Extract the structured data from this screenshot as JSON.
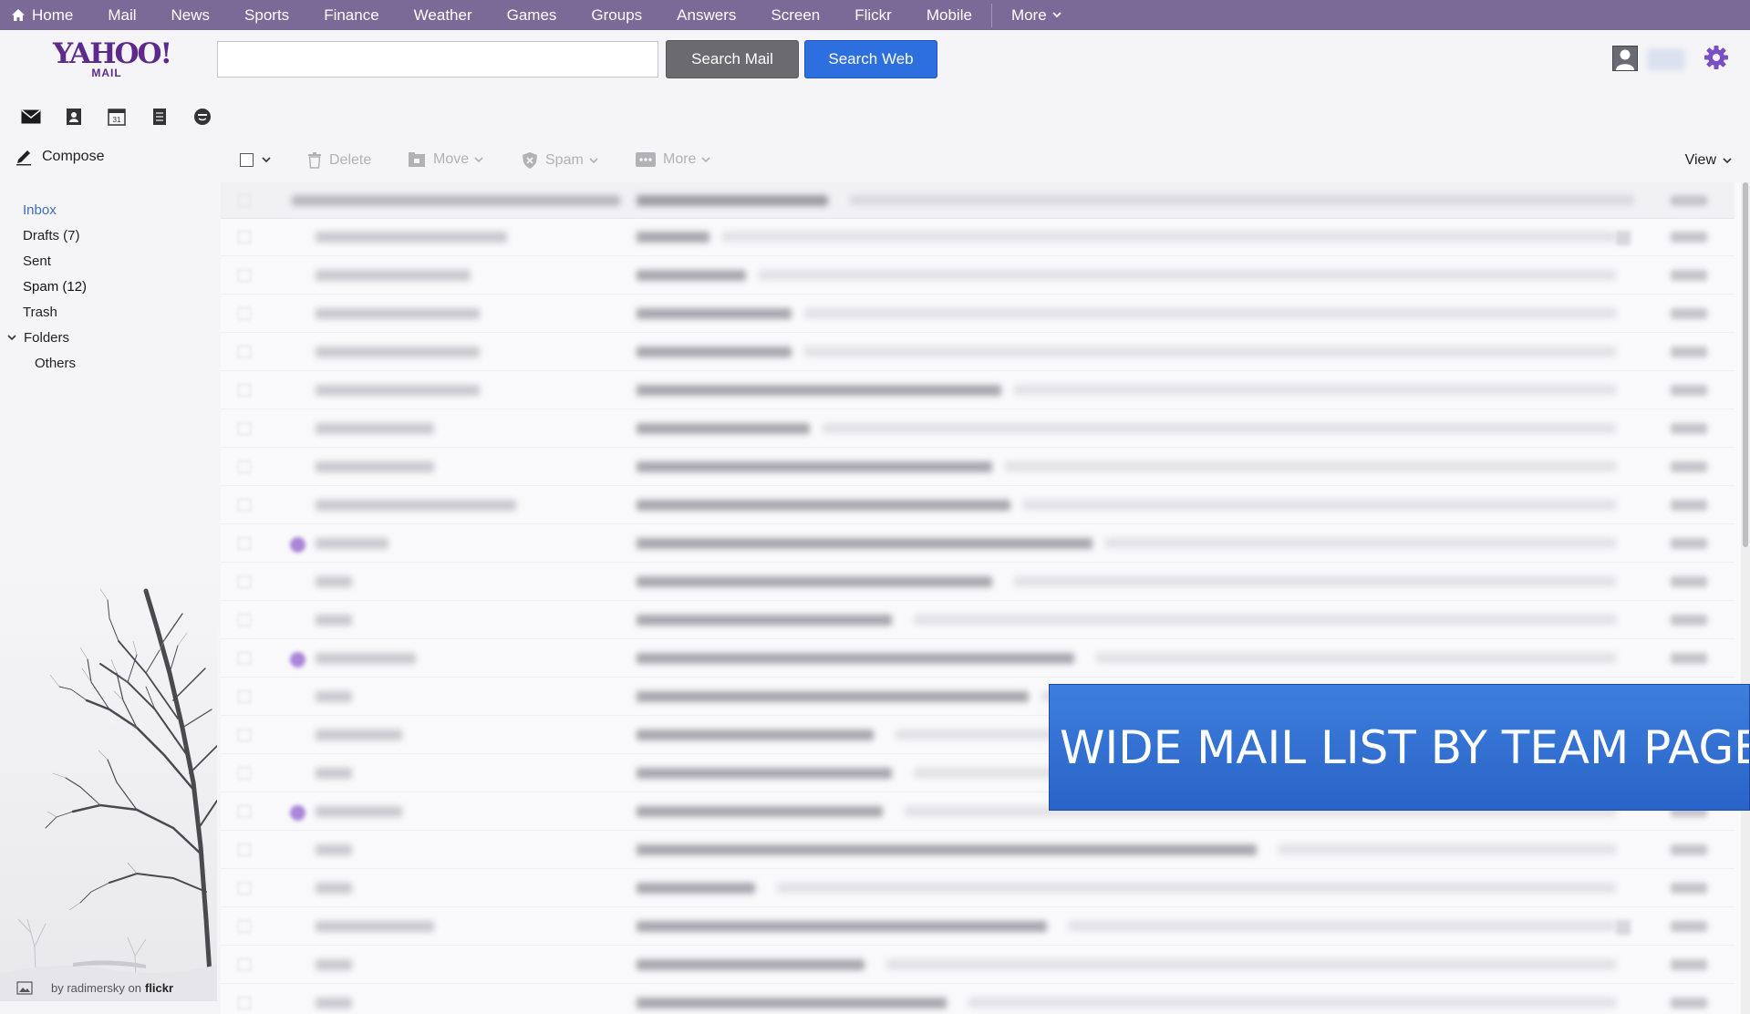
{
  "topnav": {
    "home": "Home",
    "items": [
      "Mail",
      "News",
      "Sports",
      "Finance",
      "Weather",
      "Games",
      "Groups",
      "Answers",
      "Screen",
      "Flickr",
      "Mobile"
    ],
    "more": "More"
  },
  "header": {
    "logo_main": "YAHOO!",
    "logo_sub": "MAIL",
    "search_value": "",
    "search_mail_label": "Search Mail",
    "search_web_label": "Search Web"
  },
  "app_icons": [
    "mail-icon",
    "contacts-icon",
    "calendar-icon",
    "notepad-icon",
    "messenger-icon"
  ],
  "calendar_day": "31",
  "sidebar": {
    "compose_label": "Compose",
    "folders": {
      "inbox": "Inbox",
      "drafts": "Drafts (7)",
      "sent": "Sent",
      "spam": "Spam (12)",
      "trash": "Trash",
      "folders": "Folders",
      "others": "Others"
    },
    "photo_credit": "by radimersky on",
    "photo_source": "flickr"
  },
  "toolbar": {
    "delete": "Delete",
    "move": "Move",
    "spam": "Spam",
    "more": "More",
    "view": "View"
  },
  "banner": {
    "text": "WIDE MAIL LIST BY TEAM PAGEITE"
  },
  "colors": {
    "nav_bg": "#7b6a97",
    "brand": "#5d2a8c",
    "search_web": "#2e6fe0",
    "search_mail": "#6b6b6f",
    "banner": "#3d7fdc"
  }
}
